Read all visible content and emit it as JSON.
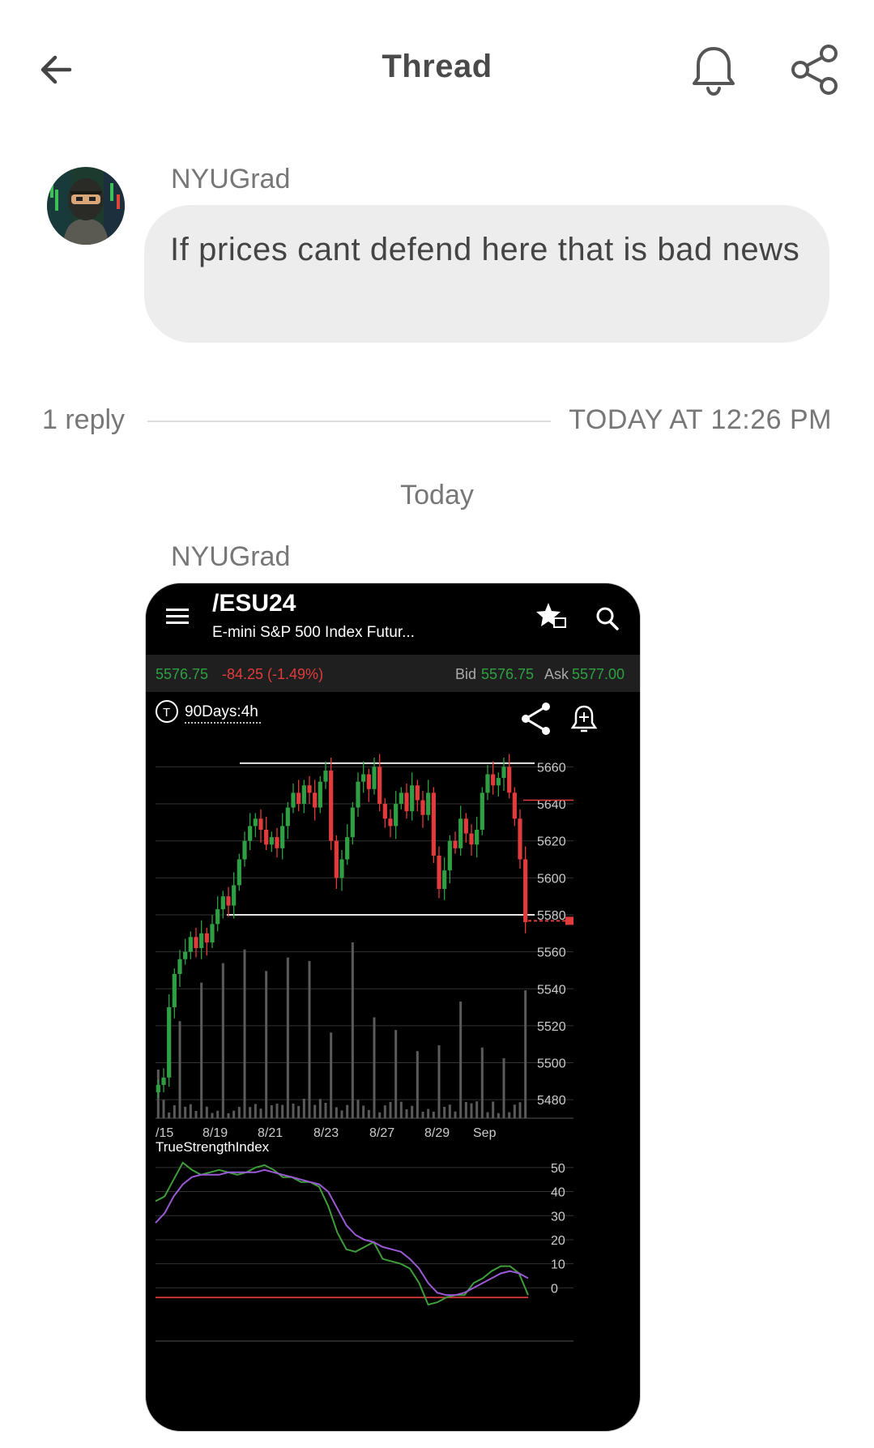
{
  "header": {
    "title": "Thread",
    "back_icon": "arrow-left-icon",
    "bell_icon": "bell-icon",
    "share_icon": "share-icon"
  },
  "message": {
    "author": "NYUGrad",
    "text": "If prices cant defend here that is bad news"
  },
  "replies": {
    "count_label": "1 reply",
    "time_label": "TODAY AT 12:26 PM"
  },
  "day_separator": "Today",
  "reply": {
    "author": "NYUGrad",
    "attachment": {
      "symbol": "/ESU24",
      "name": "E-mini S&P 500 Index Futur...",
      "last": "5576.75",
      "change": "-84.25 (-1.49%)",
      "bid_label": "Bid",
      "bid": "5576.75",
      "ask_label": "Ask",
      "ask": "5577.00",
      "timeframe": "90Days:4h",
      "indicator_label": "TrueStrengthIndex",
      "colors": {
        "up": "#2ea043",
        "down": "#e23b3b",
        "bg": "#000000",
        "toolbar": "#1e1e1e"
      }
    }
  },
  "chart_data": [
    {
      "type": "candlestick",
      "title": "",
      "x_tick_labels": [
        "/15",
        "8/19",
        "8/21",
        "8/23",
        "8/27",
        "8/29",
        "Sep"
      ],
      "y_tick_labels": [
        "5660",
        "5640",
        "5620",
        "5600",
        "5580",
        "5560",
        "5540",
        "5520",
        "5500",
        "5480"
      ],
      "ylim": [
        5470,
        5665
      ],
      "levels": [
        5662,
        5580
      ],
      "last_price": 5576.75,
      "closes": [
        5488,
        5492,
        5530,
        5548,
        5556,
        5560,
        5568,
        5562,
        5570,
        5565,
        5575,
        5583,
        5590,
        5585,
        5596,
        5610,
        5620,
        5628,
        5632,
        5626,
        5618,
        5622,
        5616,
        5628,
        5638,
        5646,
        5640,
        5650,
        5646,
        5638,
        5652,
        5658,
        5620,
        5600,
        5610,
        5622,
        5638,
        5652,
        5656,
        5648,
        5660,
        5640,
        5632,
        5628,
        5640,
        5646,
        5636,
        5650,
        5642,
        5634,
        5646,
        5612,
        5594,
        5604,
        5620,
        5616,
        5632,
        5624,
        5618,
        5626,
        5646,
        5656,
        5650,
        5654,
        5660,
        5646,
        5632,
        5610,
        5576
      ]
    },
    {
      "type": "line",
      "title": "TrueStrengthIndex",
      "y_tick_labels": [
        "50",
        "40",
        "30",
        "20",
        "10",
        "0"
      ],
      "ylim": [
        -12,
        55
      ],
      "series": [
        {
          "color": "#3f9e3a",
          "values": [
            36,
            38,
            45,
            52,
            49,
            47,
            48,
            49,
            48,
            47,
            48,
            50,
            51,
            49,
            46,
            46,
            44,
            44,
            42,
            34,
            23,
            16,
            15,
            17,
            19,
            12,
            11,
            10,
            8,
            2,
            -7,
            -6,
            -4,
            -3,
            -3,
            2,
            4,
            7,
            9,
            9,
            6,
            -3
          ]
        },
        {
          "color": "#9b59d6",
          "values": [
            27,
            31,
            38,
            43,
            46,
            47,
            47,
            47,
            48,
            48,
            48,
            48,
            49,
            48,
            47,
            46,
            45,
            44,
            43,
            40,
            33,
            26,
            22,
            20,
            19,
            17,
            16,
            15,
            12,
            8,
            2,
            -2,
            -3,
            -3,
            -2,
            0,
            2,
            4,
            6,
            7,
            6,
            4
          ]
        }
      ],
      "reference_line": 0
    }
  ]
}
